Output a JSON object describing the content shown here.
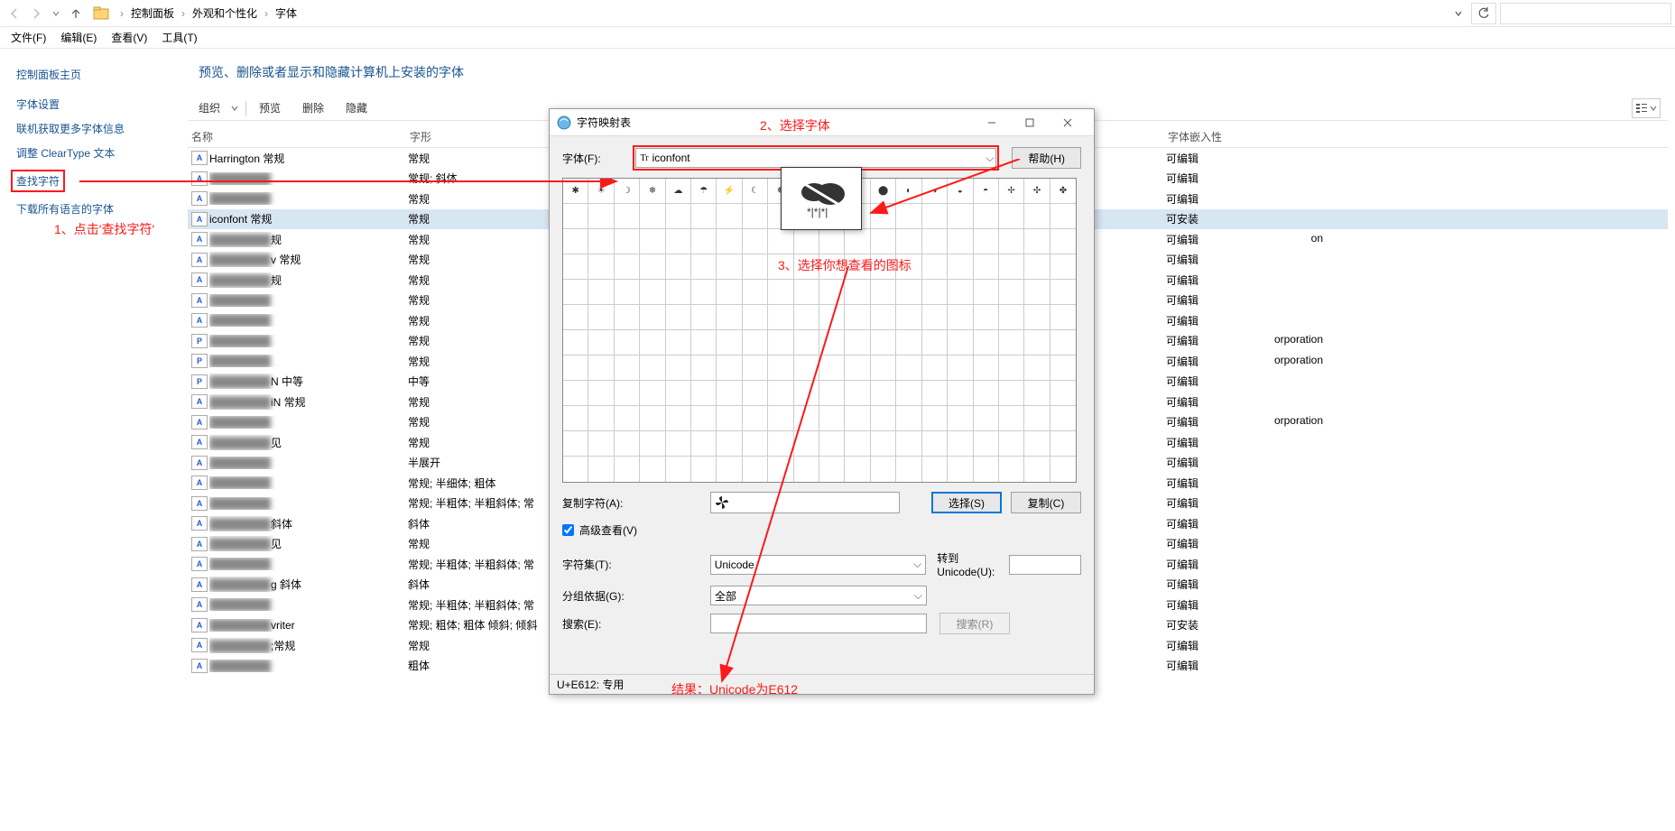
{
  "nav": {
    "breadcrumb": [
      "控制面板",
      "外观和个性化",
      "字体"
    ]
  },
  "menu": {
    "file": "文件(F)",
    "edit": "编辑(E)",
    "view": "查看(V)",
    "tools": "工具(T)"
  },
  "sidebar": {
    "home": "控制面板主页",
    "links": [
      "字体设置",
      "联机获取更多字体信息",
      "调整 ClearType 文本",
      "查找字符",
      "下载所有语言的字体"
    ]
  },
  "content": {
    "title": "预览、删除或者显示和隐藏计算机上安装的字体",
    "toolbar": {
      "organize": "组织",
      "preview": "预览",
      "delete": "删除",
      "hide": "隐藏"
    },
    "columns": {
      "name": "名称",
      "style": "字形",
      "embed": "字体嵌入性"
    }
  },
  "rows": [
    {
      "name": "Harrington 常规",
      "style": "常规",
      "embed": "可编辑",
      "visible": true,
      "icon": "A"
    },
    {
      "name": "",
      "suffix": "",
      "style": "常规; 斜体",
      "embed": "可编辑",
      "visible": false,
      "icon": "A"
    },
    {
      "name": "",
      "suffix": "",
      "style": "常规",
      "embed": "可编辑",
      "visible": false,
      "icon": "A"
    },
    {
      "name": "iconfont 常规",
      "style": "常规",
      "embed": "可安装",
      "visible": true,
      "selected": true,
      "icon": "A"
    },
    {
      "name": "",
      "suffix": "规",
      "style": "常规",
      "right_text": "on",
      "embed": "可编辑",
      "visible": false,
      "icon": "A"
    },
    {
      "name": "",
      "suffix": "v 常规",
      "style": "常规",
      "embed": "可编辑",
      "visible": false,
      "icon": "A"
    },
    {
      "name": "",
      "suffix": "规",
      "style": "常规",
      "embed": "可编辑",
      "visible": false,
      "icon": "A"
    },
    {
      "name": "",
      "suffix": "",
      "style": "常规",
      "embed": "可编辑",
      "visible": false,
      "icon": "A"
    },
    {
      "name": "",
      "suffix": "",
      "style": "常规",
      "embed": "可编辑",
      "visible": false,
      "icon": "A"
    },
    {
      "name": "",
      "suffix": "",
      "style": "常规",
      "right_text": "orporation",
      "embed": "可编辑",
      "visible": false,
      "icon": "P"
    },
    {
      "name": "",
      "suffix": "",
      "style": "常规",
      "right_text": "orporation",
      "embed": "可编辑",
      "visible": false,
      "icon": "P"
    },
    {
      "name": "",
      "suffix": "N 中等",
      "style": "中等",
      "embed": "可编辑",
      "visible": false,
      "icon": "P"
    },
    {
      "name": "",
      "suffix": "iN 常规",
      "style": "常规",
      "embed": "可编辑",
      "visible": false,
      "icon": "A"
    },
    {
      "name": "",
      "suffix": "",
      "style": "常规",
      "right_text": "orporation",
      "embed": "可编辑",
      "visible": false,
      "icon": "A"
    },
    {
      "name": "",
      "suffix": "见",
      "style": "常规",
      "embed": "可编辑",
      "visible": false,
      "icon": "A"
    },
    {
      "name": "",
      "suffix": "",
      "style": "半展开",
      "embed": "可编辑",
      "visible": false,
      "icon": "A"
    },
    {
      "name": "",
      "suffix": "",
      "style": "常规; 半细体; 粗体",
      "embed": "可编辑",
      "visible": false,
      "icon": "A"
    },
    {
      "name": "",
      "suffix": "",
      "style": "常规; 半粗体; 半粗斜体; 常",
      "embed": "可编辑",
      "visible": false,
      "icon": "A"
    },
    {
      "name": "",
      "suffix": "斜体",
      "style": "斜体",
      "embed": "可编辑",
      "visible": false,
      "icon": "A"
    },
    {
      "name": "",
      "suffix": "见",
      "style": "常规",
      "embed": "可编辑",
      "visible": false,
      "icon": "A"
    },
    {
      "name": "",
      "suffix": "",
      "style": "常规; 半粗体; 半粗斜体; 常",
      "embed": "可编辑",
      "visible": false,
      "icon": "A"
    },
    {
      "name": "",
      "suffix": "g 斜体",
      "style": "斜体",
      "embed": "可编辑",
      "visible": false,
      "icon": "A"
    },
    {
      "name": "",
      "suffix": "",
      "style": "常规; 半粗体; 半粗斜体; 常",
      "embed": "可编辑",
      "visible": false,
      "icon": "A"
    },
    {
      "name": "",
      "suffix": "vriter",
      "style": "常规; 粗体; 粗体 倾斜; 倾斜",
      "embed": "可安装",
      "visible": false,
      "icon": "A"
    },
    {
      "name": "",
      "suffix": ";常规",
      "style": "常规",
      "embed": "可编辑",
      "visible": false,
      "icon": "A"
    },
    {
      "name": "",
      "suffix": "",
      "style": "粗体",
      "embed": "可编辑",
      "visible": false,
      "icon": "A"
    }
  ],
  "annotations": {
    "a1": "1、点击'查找字符'",
    "a2": "2、选择字体",
    "a3": "3、选择你想查看的图标",
    "a4": "结果：Unicode为E612"
  },
  "dialog": {
    "title": "字符映射表",
    "font_label": "字体(F):",
    "font_value": "iconfont",
    "help_btn": "帮助(H)",
    "copy_label": "复制字符(A):",
    "select_btn": "选择(S)",
    "copy_btn": "复制(C)",
    "advanced_check": "高级查看(V)",
    "charset_label": "字符集(T):",
    "charset_value": "Unicode",
    "group_label": "分组依据(G):",
    "group_value": "全部",
    "search_label": "搜索(E):",
    "search_btn": "搜索(R)",
    "goto_label": "转到 Unicode(U):",
    "status": "U+E612: 专用"
  }
}
